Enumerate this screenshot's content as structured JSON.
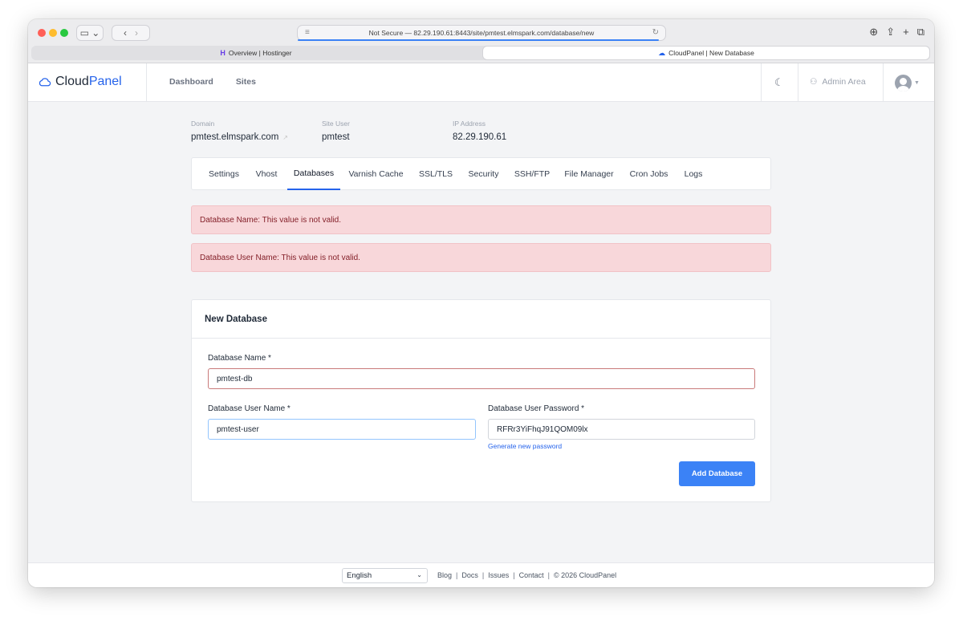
{
  "browser": {
    "address": "Not Secure — 82.29.190.61:8443/site/pmtest.elmspark.com/database/new",
    "tabs": [
      {
        "label": "Overview | Hostinger",
        "icon": "hostinger-icon"
      },
      {
        "label": "CloudPanel | New Database",
        "icon": "cloud-icon"
      }
    ]
  },
  "header": {
    "logo_part1": "Cloud",
    "logo_part2": "Panel",
    "nav": [
      "Dashboard",
      "Sites"
    ],
    "admin_area": "Admin Area"
  },
  "site": {
    "domain_label": "Domain",
    "domain": "pmtest.elmspark.com",
    "user_label": "Site User",
    "user": "pmtest",
    "ip_label": "IP Address",
    "ip": "82.29.190.61"
  },
  "site_tabs": [
    {
      "label": "Settings",
      "active": false
    },
    {
      "label": "Vhost",
      "active": false
    },
    {
      "label": "Databases",
      "active": true
    },
    {
      "label": "Varnish Cache",
      "active": false
    },
    {
      "label": "SSL/TLS",
      "active": false
    },
    {
      "label": "Security",
      "active": false
    },
    {
      "label": "SSH/FTP",
      "active": false
    },
    {
      "label": "File Manager",
      "active": false
    },
    {
      "label": "Cron Jobs",
      "active": false
    },
    {
      "label": "Logs",
      "active": false
    }
  ],
  "alerts": [
    "Database Name: This value is not valid.",
    "Database User Name: This value is not valid."
  ],
  "form": {
    "title": "New Database",
    "db_name_label": "Database Name *",
    "db_name_value": "pmtest-db",
    "db_user_label": "Database User Name *",
    "db_user_value": "pmtest-user",
    "db_pass_label": "Database User Password *",
    "db_pass_value": "RFRr3YiFhqJ91QOM09lx",
    "generate_link": "Generate new password",
    "submit": "Add Database"
  },
  "footer": {
    "language": "English",
    "links": [
      "Blog",
      "Docs",
      "Issues",
      "Contact"
    ],
    "copyright": "© 2026  CloudPanel"
  },
  "colors": {
    "accent": "#3b82f6",
    "alert_bg": "#f8d7da",
    "alert_text": "#842029"
  }
}
